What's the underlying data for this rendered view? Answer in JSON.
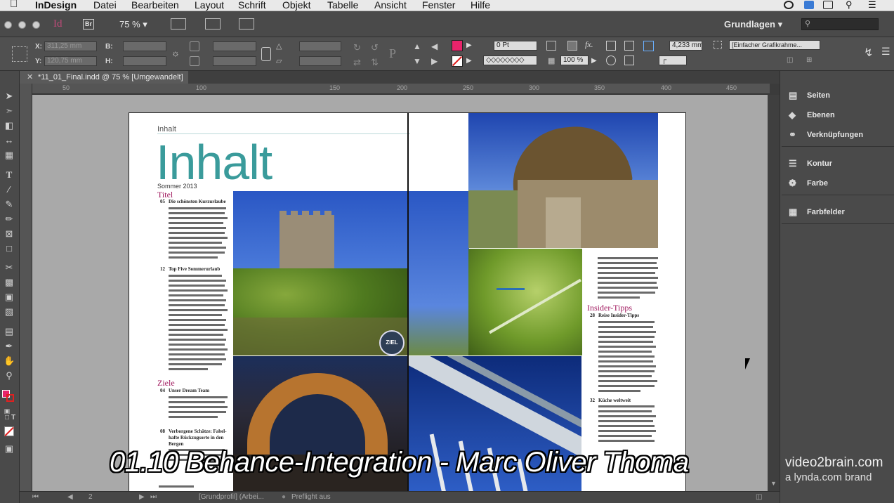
{
  "menubar": {
    "app_name": "InDesign",
    "items": [
      "Datei",
      "Bearbeiten",
      "Layout",
      "Schrift",
      "Objekt",
      "Tabelle",
      "Ansicht",
      "Fenster",
      "Hilfe"
    ]
  },
  "appbar": {
    "logo": "Id",
    "bridge": "Br",
    "zoom": "75 %",
    "workspace": "Grundlagen"
  },
  "control": {
    "x_label": "X:",
    "x_value": "311,25 mm",
    "y_label": "Y:",
    "y_value": "120,75 mm",
    "w_label": "B:",
    "h_label": "H:",
    "stroke_weight": "0 Pt",
    "stroke_width": "4,233 mm",
    "opacity": "100 %",
    "object_style": "[Einfacher Grafikrahme..."
  },
  "document": {
    "tab_title": "*11_01_Final.indd @ 75 % [Umgewandelt]",
    "ruler_ticks": [
      "50",
      "100",
      "150",
      "200",
      "250",
      "300",
      "350",
      "400",
      "450"
    ]
  },
  "spread": {
    "heading_small": "Inhalt",
    "big_title": "Inhalt",
    "season": "Sommer 2013",
    "sec_titel": "Titel",
    "entry_05_num": "05",
    "entry_05": "Die schönsten Kurzurlaube",
    "entry_12_num": "12",
    "entry_12": "Top Five Sommerurlaub",
    "sec_ziele": "Ziele",
    "entry_04_num": "04",
    "entry_04": "Unser Dream Team",
    "entry_08_num": "08",
    "entry_08_l1": "Verborgene Schätze: Fabel-",
    "entry_08_l2": "hafte Rückzugsorte in den",
    "entry_08_l3": "Bergen",
    "ziel_badge": "ZIEL",
    "sec_insider": "Insider-Tipps",
    "entry_28_num": "28",
    "entry_28": "Reise Insider-Tipps",
    "entry_32_num": "32",
    "entry_32": "Küche weltweit"
  },
  "panels": [
    {
      "label": "Seiten",
      "icon": "pages-icon"
    },
    {
      "label": "Ebenen",
      "icon": "layers-icon"
    },
    {
      "label": "Verknüpfungen",
      "icon": "links-icon"
    },
    {
      "label": "Kontur",
      "icon": "stroke-icon"
    },
    {
      "label": "Farbe",
      "icon": "color-icon"
    },
    {
      "label": "Farbfelder",
      "icon": "swatches-icon"
    }
  ],
  "statusbar": {
    "page": "2",
    "profile": "[Grundprofil] (Arbei...",
    "preflight": "Preflight aus"
  },
  "overlay": {
    "title": "01.10 Behance-Integration - Marc Oliver Thoma",
    "brand_main": "video2brain.com",
    "brand_sub": "a lynda.com brand"
  },
  "colors": {
    "accent_teal": "#3a9b9b",
    "section_magenta": "#a0185e",
    "fill_swatch": "#e8246b"
  }
}
